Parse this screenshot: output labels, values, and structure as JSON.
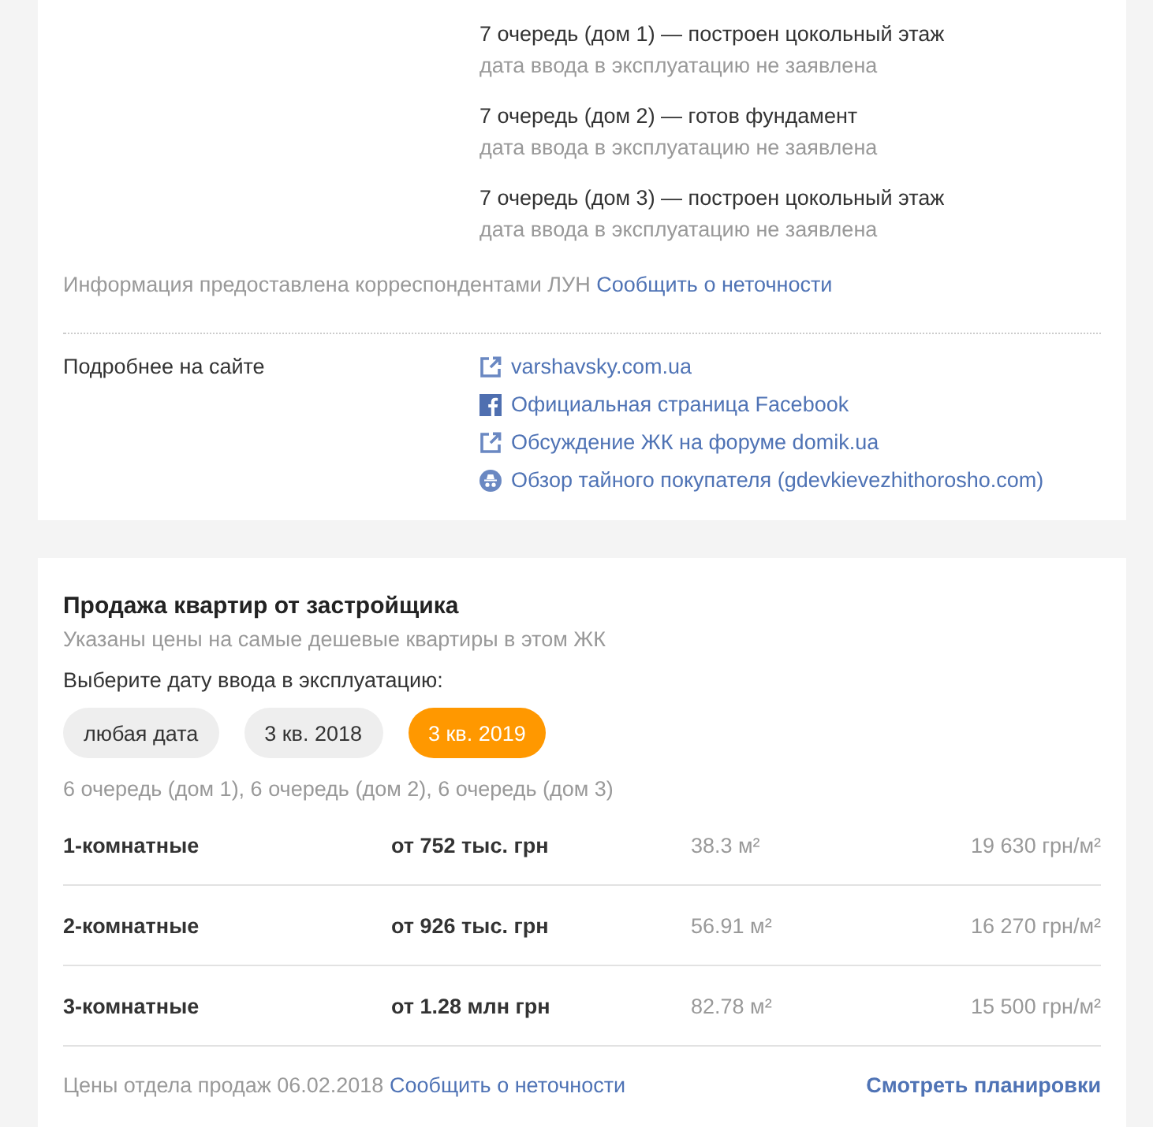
{
  "construction": {
    "queues": [
      {
        "title": "7 очередь (дом 1) — построен цокольный этаж",
        "note": "дата ввода в эксплуатацию не заявлена"
      },
      {
        "title": "7 очередь (дом 2) — готов фундамент",
        "note": "дата ввода в эксплуатацию не заявлена"
      },
      {
        "title": "7 очередь (дом 3) — построен цокольный этаж",
        "note": "дата ввода в эксплуатацию не заявлена"
      }
    ],
    "source": {
      "text": "Информация предоставлена корреспондентами ЛУН",
      "link": "Сообщить о неточности"
    },
    "more": {
      "label": "Подробнее на сайте",
      "links": [
        {
          "kind": "external",
          "text": "varshavsky.com.ua"
        },
        {
          "kind": "facebook",
          "text": "Официальная страница Facebook"
        },
        {
          "kind": "external",
          "text": "Обсуждение ЖК на форуме domik.ua"
        },
        {
          "kind": "incognito",
          "text": "Обзор тайного покупателя (gdevkievezhithorosho.com)"
        }
      ]
    }
  },
  "sales": {
    "title": "Продажа квартир от застройщика",
    "subtitle": "Указаны цены на самые дешевые квартиры в этом ЖК",
    "date_prompt": "Выберите дату ввода в эксплуатацию:",
    "date_filters": [
      {
        "label": "любая дата",
        "selected": false
      },
      {
        "label": "3 кв. 2018",
        "selected": false
      },
      {
        "label": "3 кв. 2019",
        "selected": true
      }
    ],
    "houses": "6 очередь (дом 1), 6 очередь (дом 2), 6 очередь (дом 3)",
    "rows": [
      {
        "rooms": "1-комнатные",
        "price": "от 752 тыс. грн",
        "area": "38.3 м²",
        "price_per_m2": "19 630 грн/м²"
      },
      {
        "rooms": "2-комнатные",
        "price": "от 926 тыс. грн",
        "area": "56.91 м²",
        "price_per_m2": "16 270 грн/м²"
      },
      {
        "rooms": "3-комнатные",
        "price": "от 1.28 млн грн",
        "area": "82.78 м²",
        "price_per_m2": "15 500 грн/м²"
      }
    ],
    "footer": {
      "text": "Цены отдела продаж 06.02.2018",
      "link": "Сообщить о неточности",
      "plans": "Смотреть планировки"
    }
  }
}
